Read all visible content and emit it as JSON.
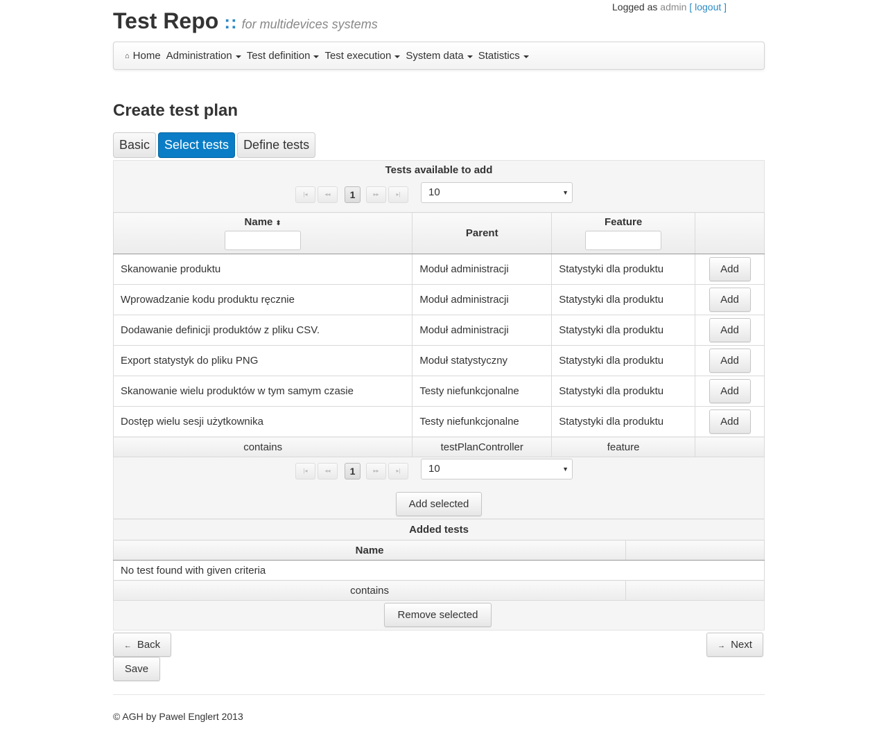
{
  "header": {
    "title": "Test Repo",
    "separator": "::",
    "subtitle": "for multidevices systems",
    "login_prefix": "Logged as",
    "user": "admin",
    "logout": "[ logout ]"
  },
  "nav": {
    "home": "Home",
    "home_icon": "⌂",
    "items": [
      "Administration",
      "Test definition",
      "Test execution",
      "System data",
      "Statistics"
    ]
  },
  "page_title": "Create test plan",
  "tabs": [
    "Basic",
    "Select tests",
    "Define tests"
  ],
  "available": {
    "title": "Tests available to add",
    "paginator": {
      "first": "|◂",
      "prev": "◂◂",
      "page": "1",
      "next": "▸▸",
      "last": "▸|",
      "rows_per_page": "10"
    },
    "columns": {
      "name": "Name",
      "sort_icon": "⬍",
      "parent": "Parent",
      "feature": "Feature"
    },
    "add_label": "Add",
    "rows": [
      {
        "name": "Skanowanie produktu",
        "parent": "Moduł administracji",
        "feature": "Statystyki dla produktu"
      },
      {
        "name": "Wprowadzanie kodu produktu ręcznie",
        "parent": "Moduł administracji",
        "feature": "Statystyki dla produktu"
      },
      {
        "name": "Dodawanie definicji produktów z pliku CSV.",
        "parent": "Moduł administracji",
        "feature": "Statystyki dla produktu"
      },
      {
        "name": "Export statystyk do pliku PNG",
        "parent": "Moduł statystyczny",
        "feature": "Statystyki dla produktu"
      },
      {
        "name": "Skanowanie wielu produktów w tym samym czasie",
        "parent": "Testy niefunkcjonalne",
        "feature": "Statystyki dla produktu"
      },
      {
        "name": "Dostęp wielu sesji użytkownika",
        "parent": "Testy niefunkcjonalne",
        "feature": "Statystyki dla produktu"
      }
    ],
    "footer": {
      "name": "contains",
      "parent": "testPlanController",
      "feature": "feature"
    },
    "add_selected": "Add selected"
  },
  "added": {
    "title": "Added tests",
    "column_name": "Name",
    "empty_message": "No test found with given criteria",
    "footer": "contains",
    "remove_selected": "Remove selected"
  },
  "actions": {
    "back": "Back",
    "back_icon": "←",
    "next": "Next",
    "next_icon": "→",
    "save": "Save"
  },
  "footer": {
    "copyright": "© AGH by Pawel Englert 2013"
  },
  "colors": {
    "accent": "#0a7dc6",
    "link": "#2b8ac4"
  }
}
